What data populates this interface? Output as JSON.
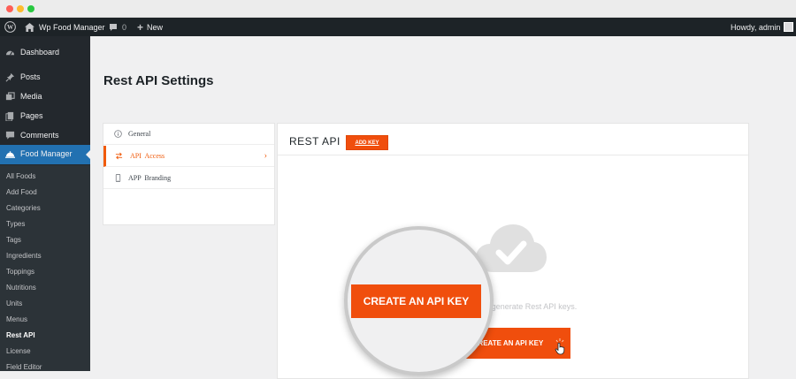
{
  "adminbar": {
    "site_name": "Wp Food Manager",
    "comments_count": "0",
    "new_label": "New",
    "greeting": "Howdy, admin"
  },
  "sidebar": {
    "items": [
      {
        "label": "Dashboard",
        "icon": "dashboard-icon"
      },
      {
        "label": "Posts",
        "icon": "pin-icon"
      },
      {
        "label": "Media",
        "icon": "media-icon"
      },
      {
        "label": "Pages",
        "icon": "pages-icon"
      },
      {
        "label": "Comments",
        "icon": "comment-icon"
      },
      {
        "label": "Food Manager",
        "icon": "food-cloche-icon"
      }
    ],
    "submenu": [
      "All Foods",
      "Add Food",
      "Categories",
      "Types",
      "Tags",
      "Ingredients",
      "Toppings",
      "Nutritions",
      "Units",
      "Menus",
      "Rest API",
      "License",
      "Field Editor"
    ],
    "current_submenu": "Rest API"
  },
  "page": {
    "title": "Rest API Settings"
  },
  "tabs": [
    {
      "label": "General",
      "icon": "info-icon"
    },
    {
      "label": "API  Access",
      "icon": "swap-arrows-icon"
    },
    {
      "label": "APP  Branding",
      "icon": "mobile-icon"
    }
  ],
  "panel": {
    "title": "REST API",
    "add_key_label": "ADD KEY",
    "empty_icon": "cloud-check-icon",
    "empty_text": "Enable and generate Rest API keys.",
    "create_label": "CREATE AN API KEY"
  },
  "magnifier": {
    "label": "CREATE AN API KEY"
  },
  "colors": {
    "accent": "#f04e0d",
    "admin_bar": "#1d2327",
    "sidebar": "#23282d",
    "active_menu": "#2271b1"
  }
}
